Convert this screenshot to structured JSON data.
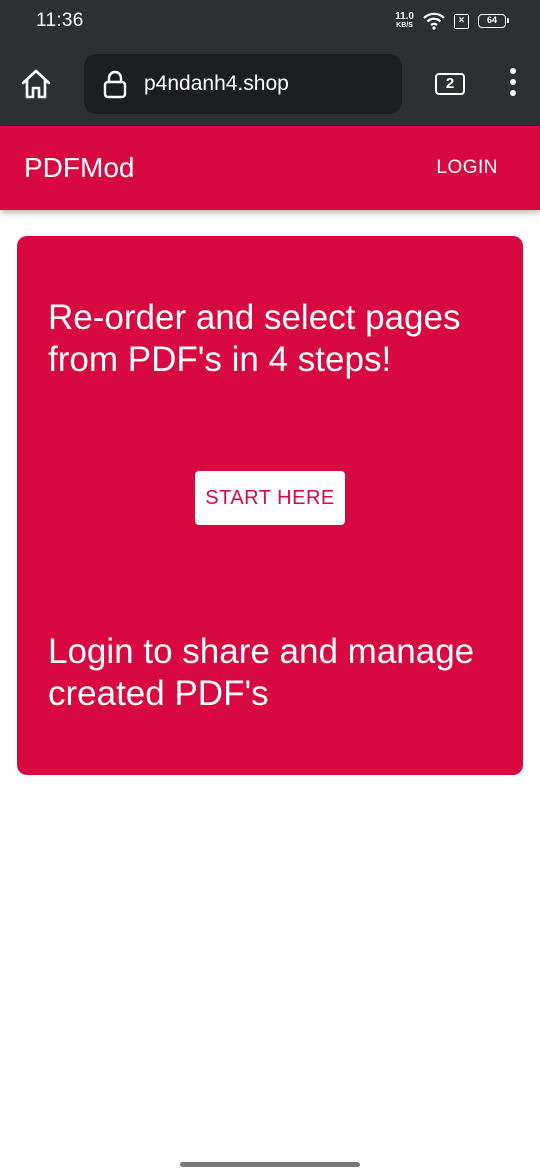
{
  "status_bar": {
    "time": "11:36",
    "net_speed_value": "11.0",
    "net_speed_unit": "KB/S",
    "battery_level": "64",
    "icons": [
      "wifi-icon",
      "sim-x-icon",
      "battery-icon"
    ]
  },
  "browser": {
    "url": "p4ndanh4.shop",
    "tab_count": "2",
    "icons": [
      "home-icon",
      "lock-icon",
      "more-vert-icon"
    ]
  },
  "app_bar": {
    "brand": "PDFMod",
    "login_label": "LOGIN"
  },
  "hero": {
    "title": "Re-order and select pages from PDF's in 4 steps!",
    "start_label": "START HERE",
    "subtitle": "Login to share and manage created PDF's"
  },
  "colors": {
    "accent": "#d80940",
    "browser_chrome": "#2e2f33",
    "url_box": "#1d1e21",
    "background": "#ffffff"
  }
}
